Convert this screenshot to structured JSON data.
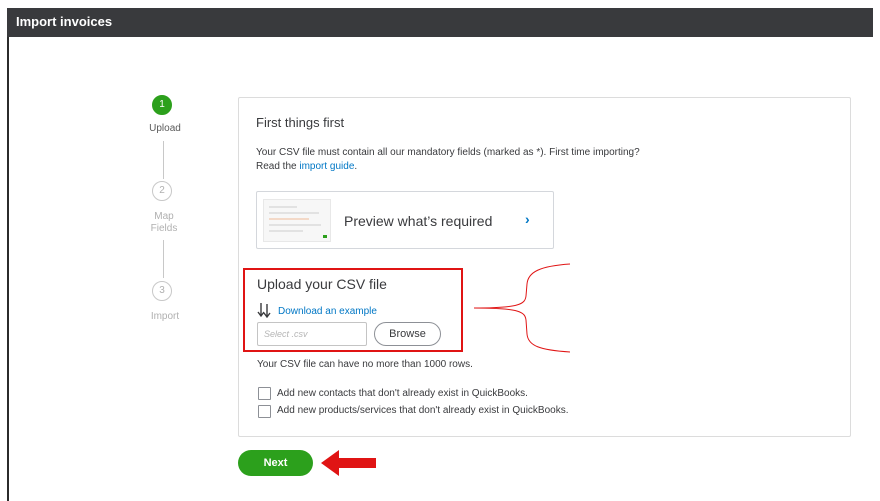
{
  "window": {
    "title": "Import invoices"
  },
  "stepper": {
    "steps": [
      {
        "number": "1",
        "label": "Upload"
      },
      {
        "number": "2",
        "label_line1": "Map",
        "label_line2": "Fields"
      },
      {
        "number": "3",
        "label": "Import"
      }
    ],
    "active_step": 1
  },
  "first_things": {
    "heading": "First things first",
    "desc_line1": "Your CSV file must contain all our mandatory fields (marked as *). First time importing?",
    "desc_read": "Read the ",
    "desc_link": "import guide",
    "desc_end": ".",
    "preview_label": "Preview what’s required",
    "preview_chevron": "›"
  },
  "upload": {
    "heading": "Upload your CSV file",
    "download_icon": "download-arrows-icon",
    "download_link": "Download an example",
    "file_placeholder": "Select .csv",
    "browse_label": "Browse",
    "rows_note": "Your CSV file can have no more than 1000 rows."
  },
  "options": {
    "add_contacts": {
      "label": "Add new contacts that don't already exist in QuickBooks.",
      "checked": false
    },
    "add_products": {
      "label": "Add new products/services that don't already exist in QuickBooks.",
      "checked": false
    }
  },
  "footer": {
    "next_label": "Next"
  },
  "colors": {
    "titlebar": "#393a3d",
    "accent_green": "#2ca01c",
    "link_blue": "#0077c5",
    "annotation_red": "#e01414"
  }
}
